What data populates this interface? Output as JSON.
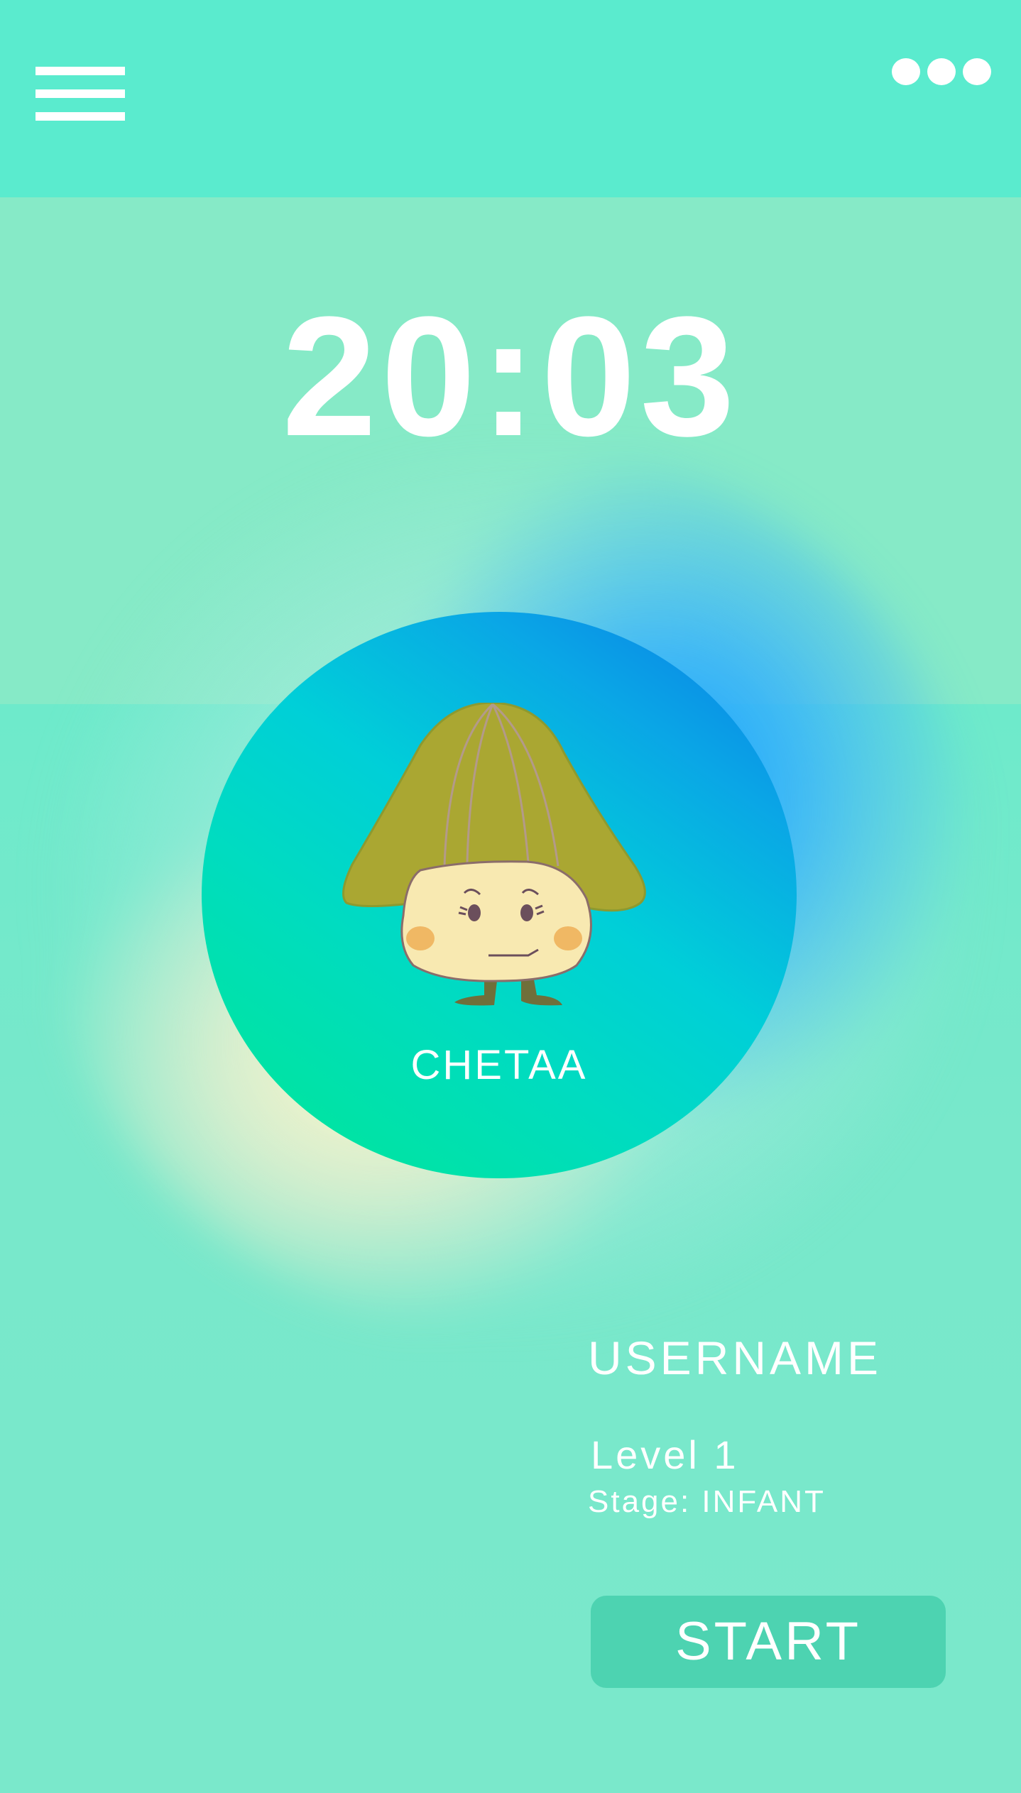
{
  "header": {
    "menu_icon": "hamburger-menu-icon",
    "more_icon": "more-dots-icon",
    "background_color": "#5aebce"
  },
  "clock": {
    "time": "20:03"
  },
  "pet": {
    "name": "CHETAA",
    "circle_gradient": [
      "#00e892",
      "#00dcc0",
      "#0a78e6"
    ]
  },
  "profile": {
    "username": "USERNAME",
    "level": "Level 1",
    "stage": "Stage: INFANT"
  },
  "actions": {
    "start_label": "START",
    "start_color": "#4dd3b1"
  }
}
